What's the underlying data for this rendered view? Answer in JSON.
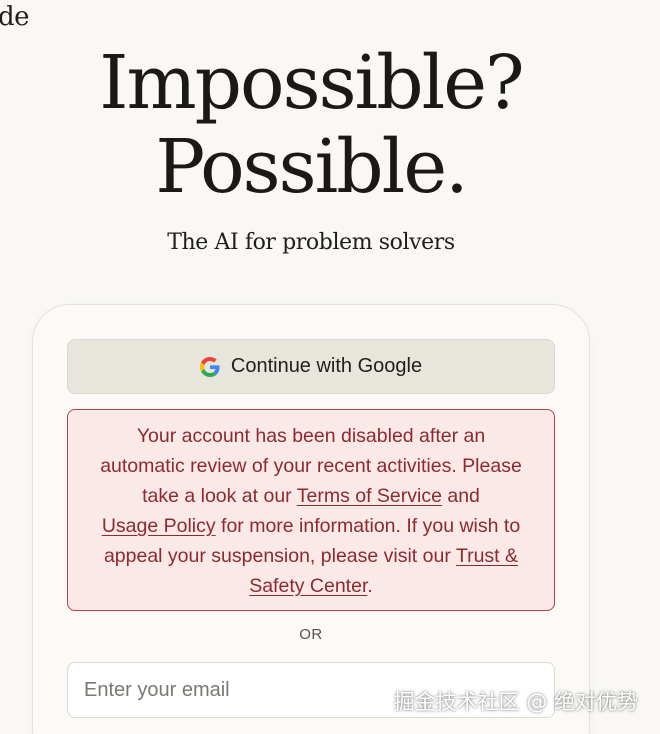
{
  "brand": {
    "logo_fragment": "de"
  },
  "hero": {
    "headline_line1": "Impossible?",
    "headline_line2": "Possible.",
    "subtitle": "The AI for problem solvers"
  },
  "login": {
    "google_button_label": "Continue with Google",
    "alert": {
      "text_1": "Your account has been disabled after an automatic review of your recent activities. Please take a look at our ",
      "link_terms": "Terms of Service",
      "text_2": " and ",
      "link_usage": "Usage Policy",
      "text_3": " for more information. If you wish to appeal your suspension, please visit our ",
      "link_trust": "Trust & Safety Center",
      "text_4": "."
    },
    "divider_label": "OR",
    "email_placeholder": "Enter your email"
  },
  "watermark": "掘金技术社区 @ 绝对优势",
  "colors": {
    "background": "#f9f8f4",
    "google_button_bg": "#e8e6dc",
    "alert_bg": "#fbe9e8",
    "alert_border": "#b3424a",
    "alert_text": "#8c2a30"
  },
  "icons": {
    "google_button": "google-logo-icon"
  }
}
